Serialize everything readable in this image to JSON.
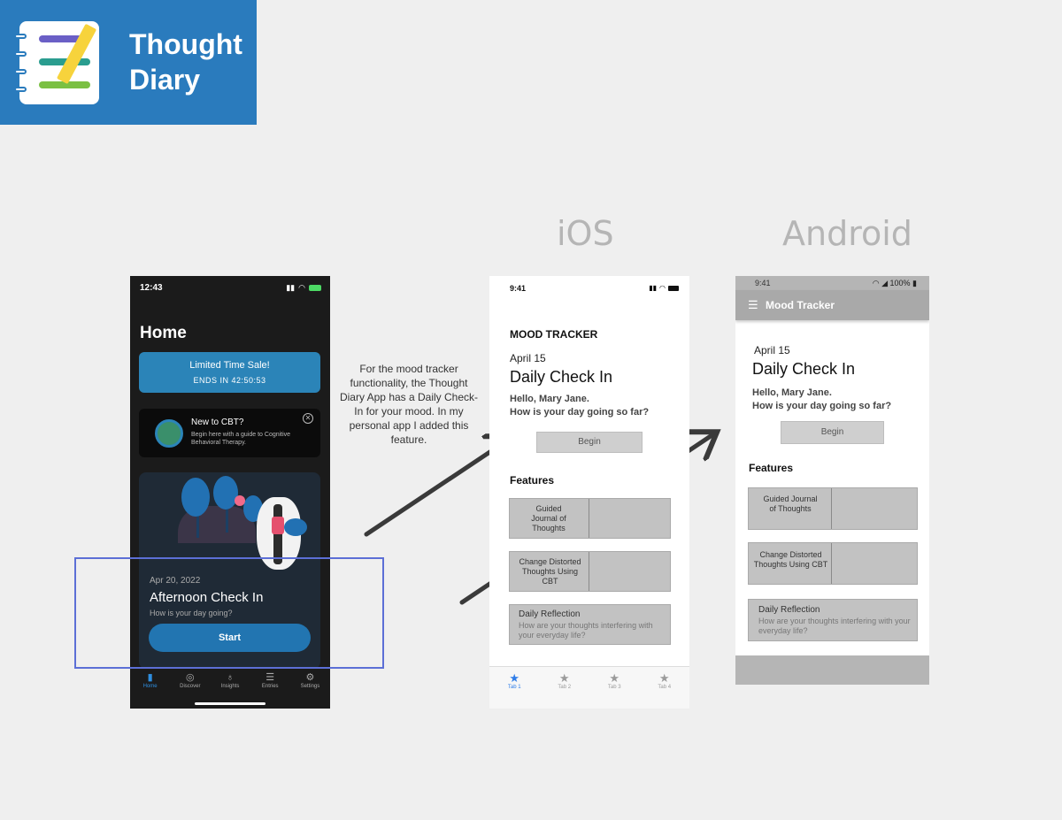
{
  "logo": {
    "line1": "Thought",
    "line2": "Diary",
    "colors": {
      "bg": "#2a7bbd",
      "purple": "#6a5fc6",
      "teal": "#2a9d8f",
      "green": "#7bc043",
      "pencil": "#f7d33c"
    }
  },
  "platforms": {
    "ios": "iOS",
    "android": "Android"
  },
  "annotation": "For the mood tracker functionality, the Thought Diary App has a Daily Check-In for your mood. In my personal app I added this feature.",
  "dark_phone": {
    "time": "12:43",
    "title": "Home",
    "sale": {
      "title": "Limited Time Sale!",
      "sub": "ENDS IN 42:50:53"
    },
    "cbt": {
      "title": "New to CBT?",
      "sub": "Begin here with a guide to Cognitive Behavioral Therapy."
    },
    "card": {
      "date": "Apr 20, 2022",
      "title": "Afternoon Check In",
      "sub": "How is your day going?",
      "button": "Start"
    },
    "tabs": [
      {
        "label": "Home",
        "icon": "book-icon"
      },
      {
        "label": "Discover",
        "icon": "compass-icon"
      },
      {
        "label": "Insights",
        "icon": "lightbulb-icon"
      },
      {
        "label": "Entries",
        "icon": "list-icon"
      },
      {
        "label": "Settings",
        "icon": "gear-icon"
      }
    ]
  },
  "ios_phone": {
    "time": "9:41",
    "section": "MOOD TRACKER",
    "date": "April 15",
    "heading": "Daily Check In",
    "hello1": "Hello, Mary Jane.",
    "hello2": "How is your day going so far?",
    "button": "Begin",
    "features": "Features",
    "card1": "Guided Journal of Thoughts",
    "card2": "Change Distorted Thoughts Using CBT",
    "card3_title": "Daily Reflection",
    "card3_sub": "How are your thoughts interfering with your everyday life?",
    "tabs": [
      "Tab 1",
      "Tab 2",
      "Tab 3",
      "Tab 4"
    ]
  },
  "android_phone": {
    "time": "9:41",
    "battery": "100%",
    "app_title": "Mood Tracker",
    "date": "April 15",
    "heading": "Daily Check In",
    "hello1": "Hello, Mary Jane.",
    "hello2": "How is your day going so far?",
    "button": "Begin",
    "features": "Features",
    "card1": "Guided Journal of Thoughts",
    "card2": "Change Distorted Thoughts Using CBT",
    "card3_title": "Daily Reflection",
    "card3_sub": "How are your thoughts interfering with your everyday life?"
  }
}
